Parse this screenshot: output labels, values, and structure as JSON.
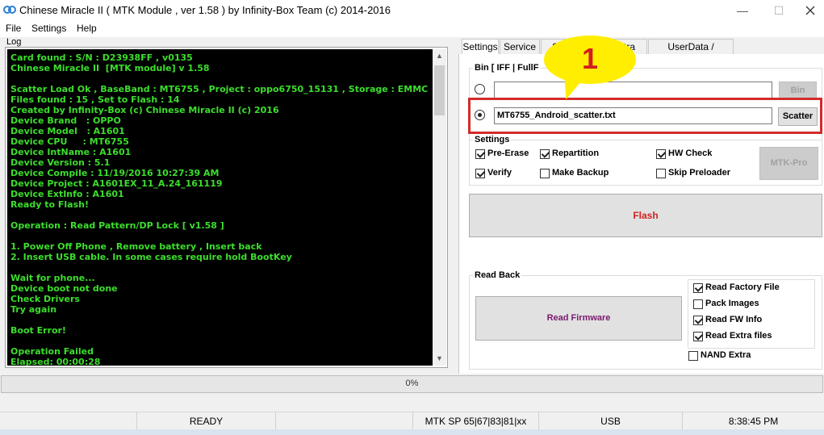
{
  "window": {
    "title": "Chinese Miracle II ( MTK Module , ver 1.58 ) by Infinity-Box Team (c) 2014-2016",
    "minimize_glyph": "—",
    "maximize_glyph": "☐",
    "icons": [
      "app-logo-icon",
      "minimize-icon",
      "maximize-icon",
      "close-icon"
    ]
  },
  "menu": [
    "File",
    "Settings",
    "Help"
  ],
  "log": {
    "label": "Log",
    "color": "#3cde2c",
    "lines": [
      "Card found : S/N : D23938FF , v0135",
      "Chinese Miracle II  [MTK module] v 1.58",
      "",
      "Scatter Load Ok , BaseBand : MT6755 , Project : oppo6750_15131 , Storage : EMMC",
      "Files found : 15 , Set to Flash : 14",
      "Created by Infinity-Box (c) Chinese Miracle II (c) 2016",
      "Device Brand   : OPPO",
      "Device Model   : A1601",
      "Device CPU     : MT6755",
      "Device IntName : A1601",
      "Device Version : 5.1",
      "Device Compile : 11/19/2016 10:27:39 AM",
      "Device Project : A1601EX_11_A.24_161119",
      "Device ExtInfo : A1601",
      "Ready to Flash!",
      "",
      "Operation : Read Pattern/DP Lock [ v1.58 ]",
      "",
      "1. Power Off Phone , Remove battery , Insert back",
      "2. Insert USB cable. In some cases require hold BootKey",
      "",
      "Wait for phone...",
      "Device boot not done",
      "Check Drivers",
      "Try again",
      "",
      "Boot Error!",
      "",
      "Operation Failed",
      "Elapsed: 00:00:28"
    ]
  },
  "tabs": [
    "Settings",
    "Service",
    "Sc",
    "tra",
    "UserData / Forensic"
  ],
  "callout": {
    "number": "1",
    "color": "#ffee00",
    "text_color": "#d21e1e"
  },
  "bin": {
    "title": "Bin  [ IFF | FullF",
    "bin_value": "",
    "bin_button": "Bin",
    "scatter_value": "MT6755_Android_scatter.txt",
    "scatter_button": "Scatter",
    "highlight_color": "#d32b2b"
  },
  "settings": {
    "title": "Settings",
    "options": [
      {
        "label": "Pre-Erase",
        "checked": true
      },
      {
        "label": "Repartition",
        "checked": true
      },
      {
        "label": "HW Check",
        "checked": true
      },
      {
        "label": "Verify",
        "checked": true
      },
      {
        "label": "Make Backup",
        "checked": false
      },
      {
        "label": "Skip Preloader",
        "checked": false
      }
    ],
    "mtkpro_button": "MTK-Pro"
  },
  "flash_button": "Flash",
  "readback": {
    "title": "Read Back",
    "read_firmware_button": "Read Firmware",
    "options": [
      {
        "label": "Read Factory File",
        "checked": true
      },
      {
        "label": "Pack Images",
        "checked": false
      },
      {
        "label": "Read FW Info",
        "checked": true
      },
      {
        "label": "Read Extra files",
        "checked": true
      }
    ],
    "nand_extra": {
      "label": "NAND Extra",
      "checked": false
    }
  },
  "progress": {
    "text": "0%",
    "value": 0,
    "fill_color": "#06b025"
  },
  "status": [
    "READY",
    "MTK SP 65|67|83|81|xx",
    "USB",
    "8:38:45 PM"
  ]
}
